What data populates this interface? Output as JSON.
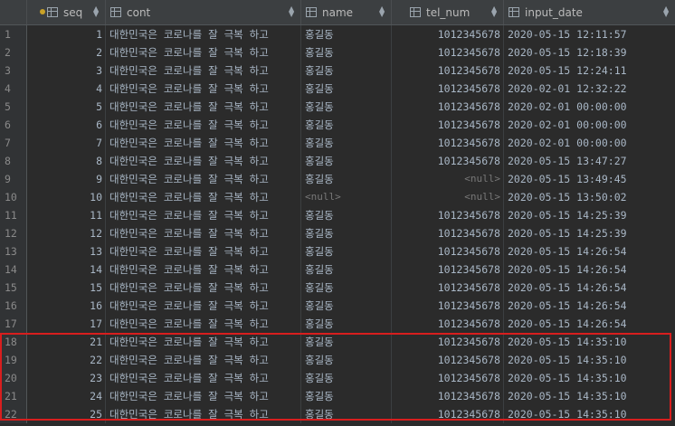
{
  "columns": {
    "seq": "seq",
    "cont": "cont",
    "name": "name",
    "tel_num": "tel_num",
    "input_date": "input_date"
  },
  "null_text": "<null>",
  "rows": [
    {
      "idx": "1",
      "seq": "1",
      "cont": "대한민국은 코로나를 잘 극복 하고",
      "name": "홍길동",
      "tel": "1012345678",
      "date": "2020-05-15 12:11:57"
    },
    {
      "idx": "2",
      "seq": "2",
      "cont": "대한민국은 코로나를 잘 극복 하고",
      "name": "홍길동",
      "tel": "1012345678",
      "date": "2020-05-15 12:18:39"
    },
    {
      "idx": "3",
      "seq": "3",
      "cont": "대한민국은 코로나를 잘 극복 하고",
      "name": "홍길동",
      "tel": "1012345678",
      "date": "2020-05-15 12:24:11"
    },
    {
      "idx": "4",
      "seq": "4",
      "cont": "대한민국은 코로나를 잘 극복 하고",
      "name": "홍길동",
      "tel": "1012345678",
      "date": "2020-02-01 12:32:22"
    },
    {
      "idx": "5",
      "seq": "5",
      "cont": "대한민국은 코로나를 잘 극복 하고",
      "name": "홍길동",
      "tel": "1012345678",
      "date": "2020-02-01 00:00:00"
    },
    {
      "idx": "6",
      "seq": "6",
      "cont": "대한민국은 코로나를 잘 극복 하고",
      "name": "홍길동",
      "tel": "1012345678",
      "date": "2020-02-01 00:00:00"
    },
    {
      "idx": "7",
      "seq": "7",
      "cont": "대한민국은 코로나를 잘 극복 하고",
      "name": "홍길동",
      "tel": "1012345678",
      "date": "2020-02-01 00:00:00"
    },
    {
      "idx": "8",
      "seq": "8",
      "cont": "대한민국은 코로나를 잘 극복 하고",
      "name": "홍길동",
      "tel": "1012345678",
      "date": "2020-05-15 13:47:27"
    },
    {
      "idx": "9",
      "seq": "9",
      "cont": "대한민국은 코로나를 잘 극복 하고",
      "name": "홍길동",
      "tel": null,
      "date": "2020-05-15 13:49:45"
    },
    {
      "idx": "10",
      "seq": "10",
      "cont": "대한민국은 코로나를 잘 극복 하고",
      "name": null,
      "tel": null,
      "date": "2020-05-15 13:50:02"
    },
    {
      "idx": "11",
      "seq": "11",
      "cont": "대한민국은 코로나를 잘 극복 하고",
      "name": "홍길동",
      "tel": "1012345678",
      "date": "2020-05-15 14:25:39"
    },
    {
      "idx": "12",
      "seq": "12",
      "cont": "대한민국은 코로나를 잘 극복 하고",
      "name": "홍길동",
      "tel": "1012345678",
      "date": "2020-05-15 14:25:39"
    },
    {
      "idx": "13",
      "seq": "13",
      "cont": "대한민국은 코로나를 잘 극복 하고",
      "name": "홍길동",
      "tel": "1012345678",
      "date": "2020-05-15 14:26:54"
    },
    {
      "idx": "14",
      "seq": "14",
      "cont": "대한민국은 코로나를 잘 극복 하고",
      "name": "홍길동",
      "tel": "1012345678",
      "date": "2020-05-15 14:26:54"
    },
    {
      "idx": "15",
      "seq": "15",
      "cont": "대한민국은 코로나를 잘 극복 하고",
      "name": "홍길동",
      "tel": "1012345678",
      "date": "2020-05-15 14:26:54"
    },
    {
      "idx": "16",
      "seq": "16",
      "cont": "대한민국은 코로나를 잘 극복 하고",
      "name": "홍길동",
      "tel": "1012345678",
      "date": "2020-05-15 14:26:54"
    },
    {
      "idx": "17",
      "seq": "17",
      "cont": "대한민국은 코로나를 잘 극복 하고",
      "name": "홍길동",
      "tel": "1012345678",
      "date": "2020-05-15 14:26:54"
    },
    {
      "idx": "18",
      "seq": "21",
      "cont": "대한민국은 코로나를 잘 극복 하고",
      "name": "홍길동",
      "tel": "1012345678",
      "date": "2020-05-15 14:35:10"
    },
    {
      "idx": "19",
      "seq": "22",
      "cont": "대한민국은 코로나를 잘 극복 하고",
      "name": "홍길동",
      "tel": "1012345678",
      "date": "2020-05-15 14:35:10"
    },
    {
      "idx": "20",
      "seq": "23",
      "cont": "대한민국은 코로나를 잘 극복 하고",
      "name": "홍길동",
      "tel": "1012345678",
      "date": "2020-05-15 14:35:10"
    },
    {
      "idx": "21",
      "seq": "24",
      "cont": "대한민국은 코로나를 잘 극복 하고",
      "name": "홍길동",
      "tel": "1012345678",
      "date": "2020-05-15 14:35:10"
    },
    {
      "idx": "22",
      "seq": "25",
      "cont": "대한민국은 코로나를 잘 극복 하고",
      "name": "홍길동",
      "tel": "1012345678",
      "date": "2020-05-15 14:35:10"
    }
  ],
  "colors": {
    "background": "#2b2b2b",
    "header": "#3c3f41",
    "text": "#a9b7c6",
    "null_text": "#787878",
    "highlight_border": "#d81e1e",
    "primary_key": "#c9a227"
  }
}
